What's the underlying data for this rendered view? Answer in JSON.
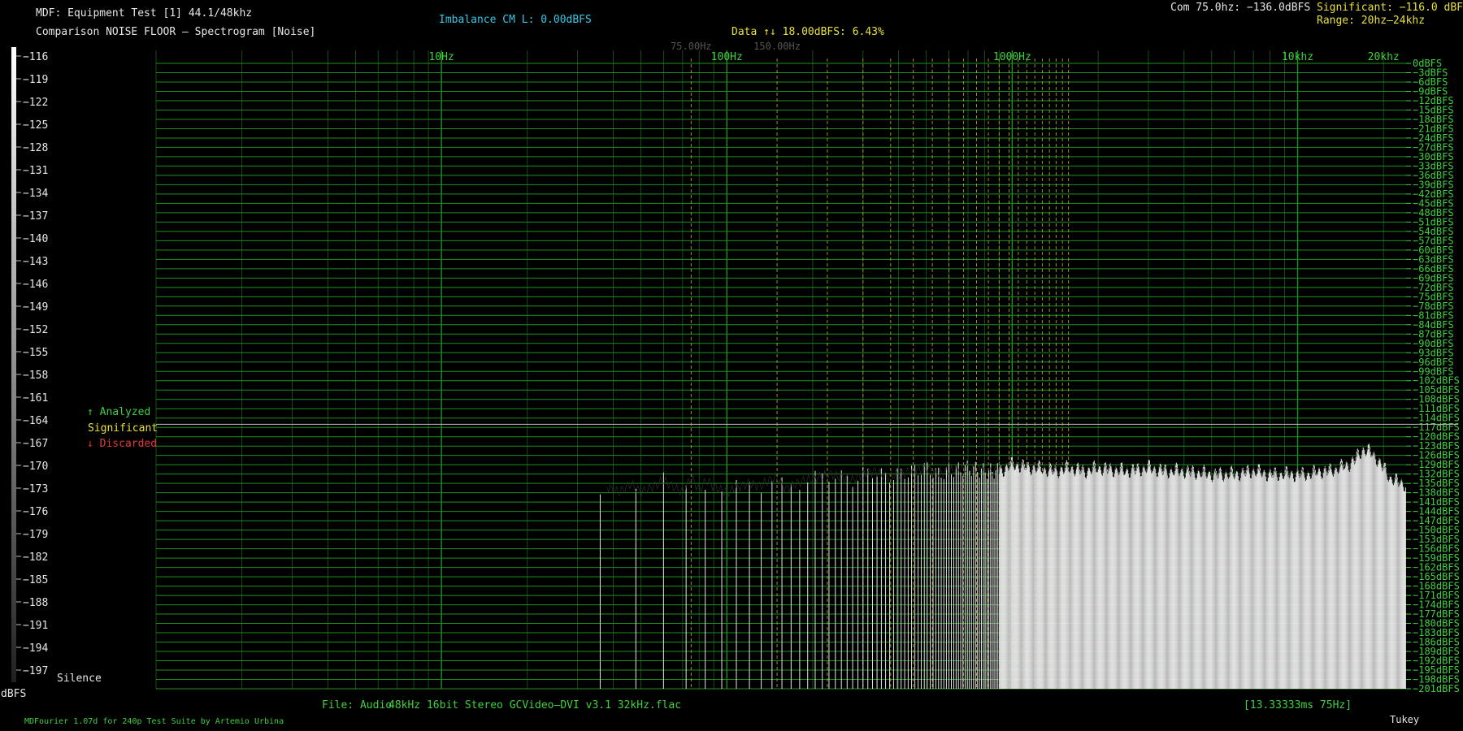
{
  "header": {
    "title": "MDF: Equipment Test [1] 44.1/48khz",
    "subtitle": "Comparison NOISE FLOOR – Spectrogram [Noise]",
    "imbalance": "Imbalance CM L: 0.00dBFS",
    "data_line": "Data ↑↓ 18.00dBFS: 6.43%",
    "com": "Com 75.0hz: −136.0dBFS",
    "significant": "Significant: −116.0 dBFS",
    "range": "Range: 20hz–24khz"
  },
  "legend": {
    "analyzed": "↑ Analyzed",
    "significant": "Significant",
    "discarded": "↓ Discarded"
  },
  "left_scale": {
    "unit": "dBFS",
    "silence": "Silence",
    "ticks": [
      "−116",
      "−119",
      "−122",
      "−125",
      "−128",
      "−131",
      "−134",
      "−137",
      "−140",
      "−143",
      "−146",
      "−149",
      "−152",
      "−155",
      "−158",
      "−161",
      "−164",
      "−167",
      "−170",
      "−173",
      "−176",
      "−179",
      "−182",
      "−185",
      "−188",
      "−191",
      "−194",
      "−197"
    ]
  },
  "footer": {
    "file": "File: Audio",
    "file_desc": "48kHz 16bit Stereo GCVideo–DVI v3.1 32kHz.flac",
    "frame": "[13.33333ms 75Hz]",
    "credit": "MDFourier 1.07d for 240p Test Suite by Artemio Urbina",
    "window": "Tukey"
  },
  "colors": {
    "grid": "#1f8f1f",
    "grid_label": "#3fd03f",
    "marker": "#b8a830",
    "spectrum": "#e4e4e4",
    "significant_line": "#bdbdbd"
  },
  "chart_data": {
    "type": "area",
    "x_scale": "log",
    "xlim": [
      1,
      24000
    ],
    "ylim": [
      -201,
      0
    ],
    "significant_level": -116,
    "floor": -201,
    "x_tick_labels": [
      {
        "value": 10,
        "label": "10Hz"
      },
      {
        "value": 100,
        "label": "100Hz"
      },
      {
        "value": 1000,
        "label": "1000Hz"
      },
      {
        "value": 10000,
        "label": "10khz"
      },
      {
        "value": 20000,
        "label": "20khz"
      }
    ],
    "marker_labels": [
      {
        "value": 75,
        "label": "75.00Hz"
      },
      {
        "value": 150,
        "label": "150.00Hz"
      }
    ],
    "marker_harmonics": [
      75,
      150,
      225,
      300,
      375,
      450,
      525,
      600,
      675,
      750,
      825,
      900,
      975,
      1050,
      1125,
      1200,
      1275,
      1350,
      1425,
      1500,
      1575
    ],
    "y_tick_labels": [
      "0dBFS",
      "−3dBFS",
      "−6dBFS",
      "−9dBFS",
      "−12dBFS",
      "−15dBFS",
      "−18dBFS",
      "−21dBFS",
      "−24dBFS",
      "−27dBFS",
      "−30dBFS",
      "−33dBFS",
      "−36dBFS",
      "−39dBFS",
      "−42dBFS",
      "−45dBFS",
      "−48dBFS",
      "−51dBFS",
      "−54dBFS",
      "−57dBFS",
      "−60dBFS",
      "−63dBFS",
      "−66dBFS",
      "−69dBFS",
      "−72dBFS",
      "−75dBFS",
      "−78dBFS",
      "−81dBFS",
      "−84dBFS",
      "−87dBFS",
      "−90dBFS",
      "−93dBFS",
      "−96dBFS",
      "−99dBFS",
      "−102dBFS",
      "−105dBFS",
      "−108dBFS",
      "−111dBFS",
      "−114dBFS",
      "−117dBFS",
      "−120dBFS",
      "−123dBFS",
      "−126dBFS",
      "−129dBFS",
      "−132dBFS",
      "−135dBFS",
      "−138dBFS",
      "−141dBFS",
      "−144dBFS",
      "−147dBFS",
      "−150dBFS",
      "−153dBFS",
      "−156dBFS",
      "−159dBFS",
      "−162dBFS",
      "−165dBFS",
      "−168dBFS",
      "−171dBFS",
      "−174dBFS",
      "−177dBFS",
      "−180dBFS",
      "−183dBFS",
      "−186dBFS",
      "−189dBFS",
      "−192dBFS",
      "−195dBFS",
      "−198dBFS",
      "−201dBFS"
    ],
    "series": [
      {
        "x": [
          38,
          42,
          46,
          50,
          55,
          60,
          65,
          70,
          75,
          80,
          85,
          90,
          100,
          110,
          120,
          130,
          140,
          150,
          160,
          175,
          190,
          210,
          230,
          250,
          275,
          300,
          330,
          360,
          400,
          450,
          500,
          550,
          600,
          700,
          800,
          900,
          1000,
          1200,
          1400,
          1600,
          1800,
          2000,
          2500,
          3000,
          3500,
          4000,
          5000,
          6000,
          7000,
          8000,
          9000,
          10000,
          11000,
          12000,
          13000,
          14000,
          15000,
          16000,
          17000,
          18000,
          19000,
          20000,
          21000,
          22000,
          23000,
          24000
        ],
        "values": [
          -136,
          -138,
          -135,
          -138,
          -136,
          -134,
          -136,
          -138,
          -133,
          -137,
          -134,
          -136,
          -138,
          -136,
          -135,
          -136,
          -134,
          -133,
          -137,
          -135,
          -134,
          -133,
          -132,
          -133,
          -134,
          -132,
          -131,
          -133,
          -132,
          -131,
          -130,
          -132,
          -131,
          -130,
          -131,
          -131,
          -129,
          -130,
          -131,
          -130,
          -131,
          -130,
          -131,
          -130,
          -131,
          -131,
          -132,
          -132,
          -131,
          -132,
          -132,
          -132,
          -132,
          -131,
          -131,
          -130,
          -129,
          -127,
          -124,
          -125,
          -127,
          -130,
          -133,
          -134,
          -135,
          -135
        ]
      }
    ]
  }
}
